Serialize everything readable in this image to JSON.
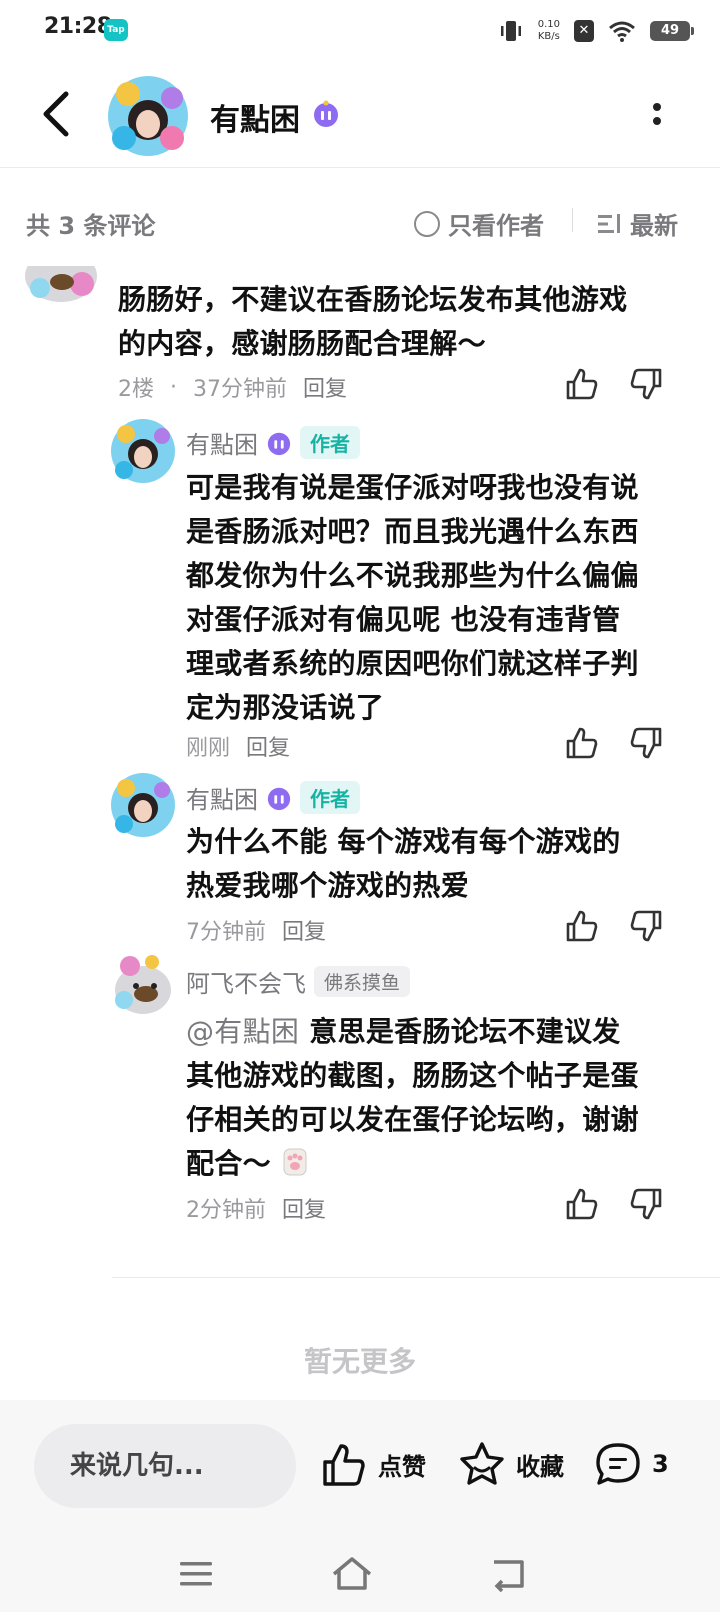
{
  "status_bar": {
    "time": "21:28",
    "tap_label": "Tap",
    "net_speed_value": "0.10",
    "net_speed_unit": "KB/s",
    "battery": "49"
  },
  "header": {
    "username": "有點困"
  },
  "comments_header": {
    "count_text": "共 3 条评论",
    "only_author": "只看作者",
    "sort": "最新"
  },
  "comments": [
    {
      "text_line1": "肠肠好，不建议在香肠论坛发布其他游戏",
      "text_line2": "的内容，感谢肠肠配合理解～",
      "floor": "2楼",
      "dot": "·",
      "time": "37分钟前",
      "reply": "回复"
    }
  ],
  "replies": [
    {
      "name": "有點困",
      "tag": "作者",
      "lines": [
        "可是我有说是蛋仔派对呀我也没有说",
        "是香肠派对吧？而且我光遇什么东西",
        "都发你为什么不说我那些为什么偏偏",
        "对蛋仔派对有偏见呢 也没有违背管",
        "理或者系统的原因吧你们就这样子判",
        "定为那没话说了"
      ],
      "time": "刚刚",
      "reply": "回复"
    },
    {
      "name": "有點困",
      "tag": "作者",
      "lines": [
        "为什么不能 每个游戏有每个游戏的",
        "热爱我哪个游戏的热爱"
      ],
      "time": "7分钟前",
      "reply": "回复"
    },
    {
      "name": "阿飞不会飞",
      "tag": "佛系摸鱼",
      "mention": "@有點困",
      "lines": [
        "意思是香肠论坛不建议发",
        "其他游戏的截图，肠肠这个帖子是蛋",
        "仔相关的可以发在蛋仔论坛哟，谢谢",
        "配合～"
      ],
      "time": "2分钟前",
      "reply": "回复"
    }
  ],
  "no_more": "暂无更多",
  "bottom_bar": {
    "input_placeholder": "来说几句...",
    "like": "点赞",
    "favorite": "收藏",
    "comment_count": "3"
  },
  "colors": {
    "accent": "#16b3a4",
    "tag_bg": "#e2f7f5",
    "text": "#111111",
    "muted": "#9a9a9e"
  }
}
